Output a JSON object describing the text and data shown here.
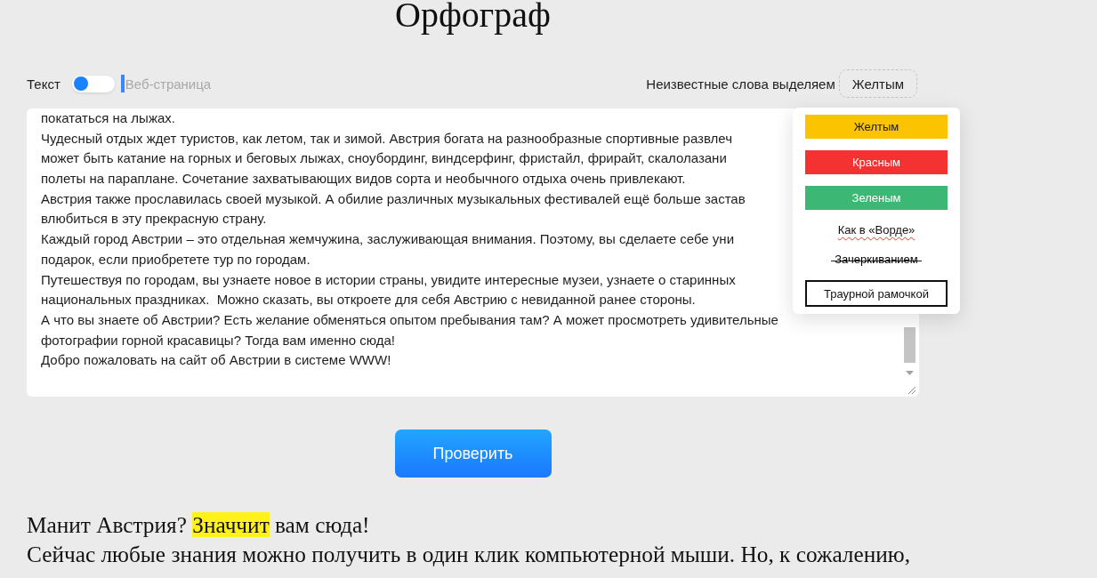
{
  "app": {
    "title": "Орфограф"
  },
  "mode_switch": {
    "left_label": "Текст",
    "right_label": "Веб-страница",
    "on": false
  },
  "highlight_picker": {
    "label": "Неизвестные слова выделяем",
    "value": "Желтым",
    "expanded": true,
    "options": [
      {
        "kind": "fill",
        "label": "Желтым",
        "color": "#fcc400"
      },
      {
        "kind": "fill",
        "label": "Красным",
        "color": "#f53232"
      },
      {
        "kind": "fill",
        "label": "Зеленым",
        "color": "#3db874"
      },
      {
        "kind": "wavy",
        "label": "Как в «Ворде»"
      },
      {
        "kind": "strike",
        "label": "Зачеркиванием"
      },
      {
        "kind": "frame",
        "label": "Траурной рамочкой"
      }
    ]
  },
  "text_input": {
    "lines": [
      "покататься на лыжах.",
      "Чудесный отдых ждет туристов, как летом, так и зимой. Австрия богата на разнообразные спортивные развлеч",
      "может быть катание на горных и беговых лыжах, сноубординг, виндсерфинг, фристайл, фрирайт, скалолазани",
      "полеты на параплане. Сочетание захватывающих видов сорта и необычного отдыха очень привлекают.",
      "Австрия также прославилась своей музыкой. А обилие различных музыкальных фестивалей ещё больше застав",
      "влюбиться в эту прекрасную страну.",
      "Каждый город Австрии – это отдельная жемчужина, заслуживающая внимания. Поэтому, вы сделаете себе уни",
      "подарок, если приобретете тур по городам.",
      "Путешествуя по городам, вы узнаете новое в истории страны, увидите интересные музеи, узнаете о старинных",
      "национальных праздниках.  Можно сказать, вы откроете для себя Австрию с невиданной ранее стороны.",
      "А что вы знаете об Австрии? Есть желание обменяться опытом пребывания там? А может просмотреть удивительные",
      "фотографии горной красавицы? Тогда вам именно сюда!",
      "Добро пожаловать на сайт об Австрии в системе WWW!"
    ]
  },
  "check_button": {
    "label": "Проверить"
  },
  "result": {
    "lines": [
      {
        "segments": [
          {
            "text": "Манит Австрия? ",
            "unknown": false
          },
          {
            "text": "Значчит",
            "unknown": true
          },
          {
            "text": " вам сюда!",
            "unknown": false
          }
        ]
      },
      {
        "segments": [
          {
            "text": "Сейчас любые знания можно получить в один клик компьютерной мыши. Но, к сожалению,",
            "unknown": false
          }
        ]
      }
    ]
  }
}
